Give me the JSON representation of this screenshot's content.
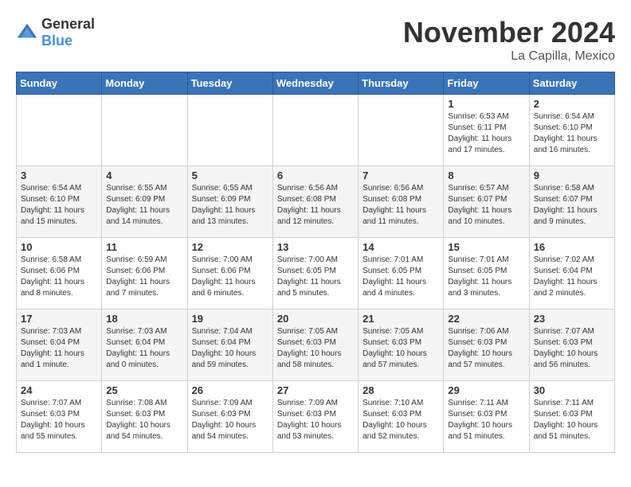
{
  "logo": {
    "general": "General",
    "blue": "Blue"
  },
  "title": "November 2024",
  "location": "La Capilla, Mexico",
  "days_of_week": [
    "Sunday",
    "Monday",
    "Tuesday",
    "Wednesday",
    "Thursday",
    "Friday",
    "Saturday"
  ],
  "weeks": [
    [
      {
        "day": "",
        "info": ""
      },
      {
        "day": "",
        "info": ""
      },
      {
        "day": "",
        "info": ""
      },
      {
        "day": "",
        "info": ""
      },
      {
        "day": "",
        "info": ""
      },
      {
        "day": "1",
        "info": "Sunrise: 6:53 AM\nSunset: 6:11 PM\nDaylight: 11 hours and 17 minutes."
      },
      {
        "day": "2",
        "info": "Sunrise: 6:54 AM\nSunset: 6:10 PM\nDaylight: 11 hours and 16 minutes."
      }
    ],
    [
      {
        "day": "3",
        "info": "Sunrise: 6:54 AM\nSunset: 6:10 PM\nDaylight: 11 hours and 15 minutes."
      },
      {
        "day": "4",
        "info": "Sunrise: 6:55 AM\nSunset: 6:09 PM\nDaylight: 11 hours and 14 minutes."
      },
      {
        "day": "5",
        "info": "Sunrise: 6:55 AM\nSunset: 6:09 PM\nDaylight: 11 hours and 13 minutes."
      },
      {
        "day": "6",
        "info": "Sunrise: 6:56 AM\nSunset: 6:08 PM\nDaylight: 11 hours and 12 minutes."
      },
      {
        "day": "7",
        "info": "Sunrise: 6:56 AM\nSunset: 6:08 PM\nDaylight: 11 hours and 11 minutes."
      },
      {
        "day": "8",
        "info": "Sunrise: 6:57 AM\nSunset: 6:07 PM\nDaylight: 11 hours and 10 minutes."
      },
      {
        "day": "9",
        "info": "Sunrise: 6:58 AM\nSunset: 6:07 PM\nDaylight: 11 hours and 9 minutes."
      }
    ],
    [
      {
        "day": "10",
        "info": "Sunrise: 6:58 AM\nSunset: 6:06 PM\nDaylight: 11 hours and 8 minutes."
      },
      {
        "day": "11",
        "info": "Sunrise: 6:59 AM\nSunset: 6:06 PM\nDaylight: 11 hours and 7 minutes."
      },
      {
        "day": "12",
        "info": "Sunrise: 7:00 AM\nSunset: 6:06 PM\nDaylight: 11 hours and 6 minutes."
      },
      {
        "day": "13",
        "info": "Sunrise: 7:00 AM\nSunset: 6:05 PM\nDaylight: 11 hours and 5 minutes."
      },
      {
        "day": "14",
        "info": "Sunrise: 7:01 AM\nSunset: 6:05 PM\nDaylight: 11 hours and 4 minutes."
      },
      {
        "day": "15",
        "info": "Sunrise: 7:01 AM\nSunset: 6:05 PM\nDaylight: 11 hours and 3 minutes."
      },
      {
        "day": "16",
        "info": "Sunrise: 7:02 AM\nSunset: 6:04 PM\nDaylight: 11 hours and 2 minutes."
      }
    ],
    [
      {
        "day": "17",
        "info": "Sunrise: 7:03 AM\nSunset: 6:04 PM\nDaylight: 11 hours and 1 minute."
      },
      {
        "day": "18",
        "info": "Sunrise: 7:03 AM\nSunset: 6:04 PM\nDaylight: 11 hours and 0 minutes."
      },
      {
        "day": "19",
        "info": "Sunrise: 7:04 AM\nSunset: 6:04 PM\nDaylight: 10 hours and 59 minutes."
      },
      {
        "day": "20",
        "info": "Sunrise: 7:05 AM\nSunset: 6:03 PM\nDaylight: 10 hours and 58 minutes."
      },
      {
        "day": "21",
        "info": "Sunrise: 7:05 AM\nSunset: 6:03 PM\nDaylight: 10 hours and 57 minutes."
      },
      {
        "day": "22",
        "info": "Sunrise: 7:06 AM\nSunset: 6:03 PM\nDaylight: 10 hours and 57 minutes."
      },
      {
        "day": "23",
        "info": "Sunrise: 7:07 AM\nSunset: 6:03 PM\nDaylight: 10 hours and 56 minutes."
      }
    ],
    [
      {
        "day": "24",
        "info": "Sunrise: 7:07 AM\nSunset: 6:03 PM\nDaylight: 10 hours and 55 minutes."
      },
      {
        "day": "25",
        "info": "Sunrise: 7:08 AM\nSunset: 6:03 PM\nDaylight: 10 hours and 54 minutes."
      },
      {
        "day": "26",
        "info": "Sunrise: 7:09 AM\nSunset: 6:03 PM\nDaylight: 10 hours and 54 minutes."
      },
      {
        "day": "27",
        "info": "Sunrise: 7:09 AM\nSunset: 6:03 PM\nDaylight: 10 hours and 53 minutes."
      },
      {
        "day": "28",
        "info": "Sunrise: 7:10 AM\nSunset: 6:03 PM\nDaylight: 10 hours and 52 minutes."
      },
      {
        "day": "29",
        "info": "Sunrise: 7:11 AM\nSunset: 6:03 PM\nDaylight: 10 hours and 51 minutes."
      },
      {
        "day": "30",
        "info": "Sunrise: 7:11 AM\nSunset: 6:03 PM\nDaylight: 10 hours and 51 minutes."
      }
    ]
  ]
}
